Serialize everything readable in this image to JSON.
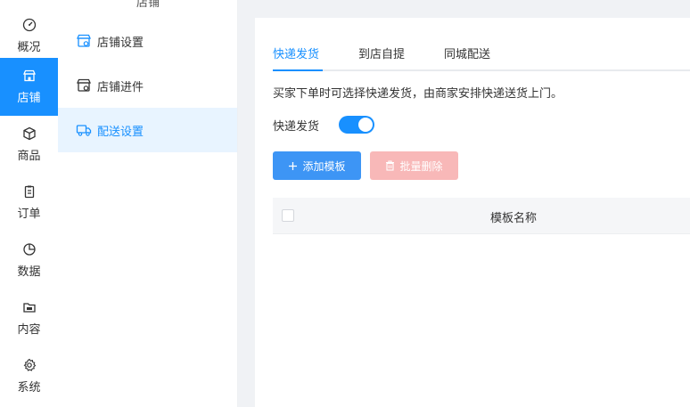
{
  "rail": {
    "items": [
      {
        "label": "概况",
        "icon": "dashboard-icon"
      },
      {
        "label": "店铺",
        "icon": "store-icon"
      },
      {
        "label": "商品",
        "icon": "product-box-icon"
      },
      {
        "label": "订单",
        "icon": "order-clipboard-icon"
      },
      {
        "label": "数据",
        "icon": "chart-pie-icon"
      },
      {
        "label": "内容",
        "icon": "folder-icon"
      },
      {
        "label": "系统",
        "icon": "gear-icon"
      }
    ],
    "active_index": 1
  },
  "submenu": {
    "title": "店铺",
    "items": [
      {
        "label": "店铺设置",
        "icon": "store-settings-icon"
      },
      {
        "label": "店铺进件",
        "icon": "store-onboard-icon"
      },
      {
        "label": "配送设置",
        "icon": "delivery-truck-icon"
      }
    ],
    "active_index": 2
  },
  "tabs": [
    {
      "label": "快递发货"
    },
    {
      "label": "到店自提"
    },
    {
      "label": "同城配送"
    }
  ],
  "active_tab": 0,
  "description": "买家下单时可选择快递发货，由商家安排快递送货上门。",
  "toggle": {
    "label": "快递发货",
    "on": true
  },
  "buttons": {
    "add_label": "添加模板",
    "delete_label": "批量删除"
  },
  "table": {
    "columns": [
      "模板名称"
    ]
  },
  "colors": {
    "accent": "#1890ff",
    "danger_disabled": "#f8b8b8",
    "active_bg": "#e8f4ff"
  }
}
